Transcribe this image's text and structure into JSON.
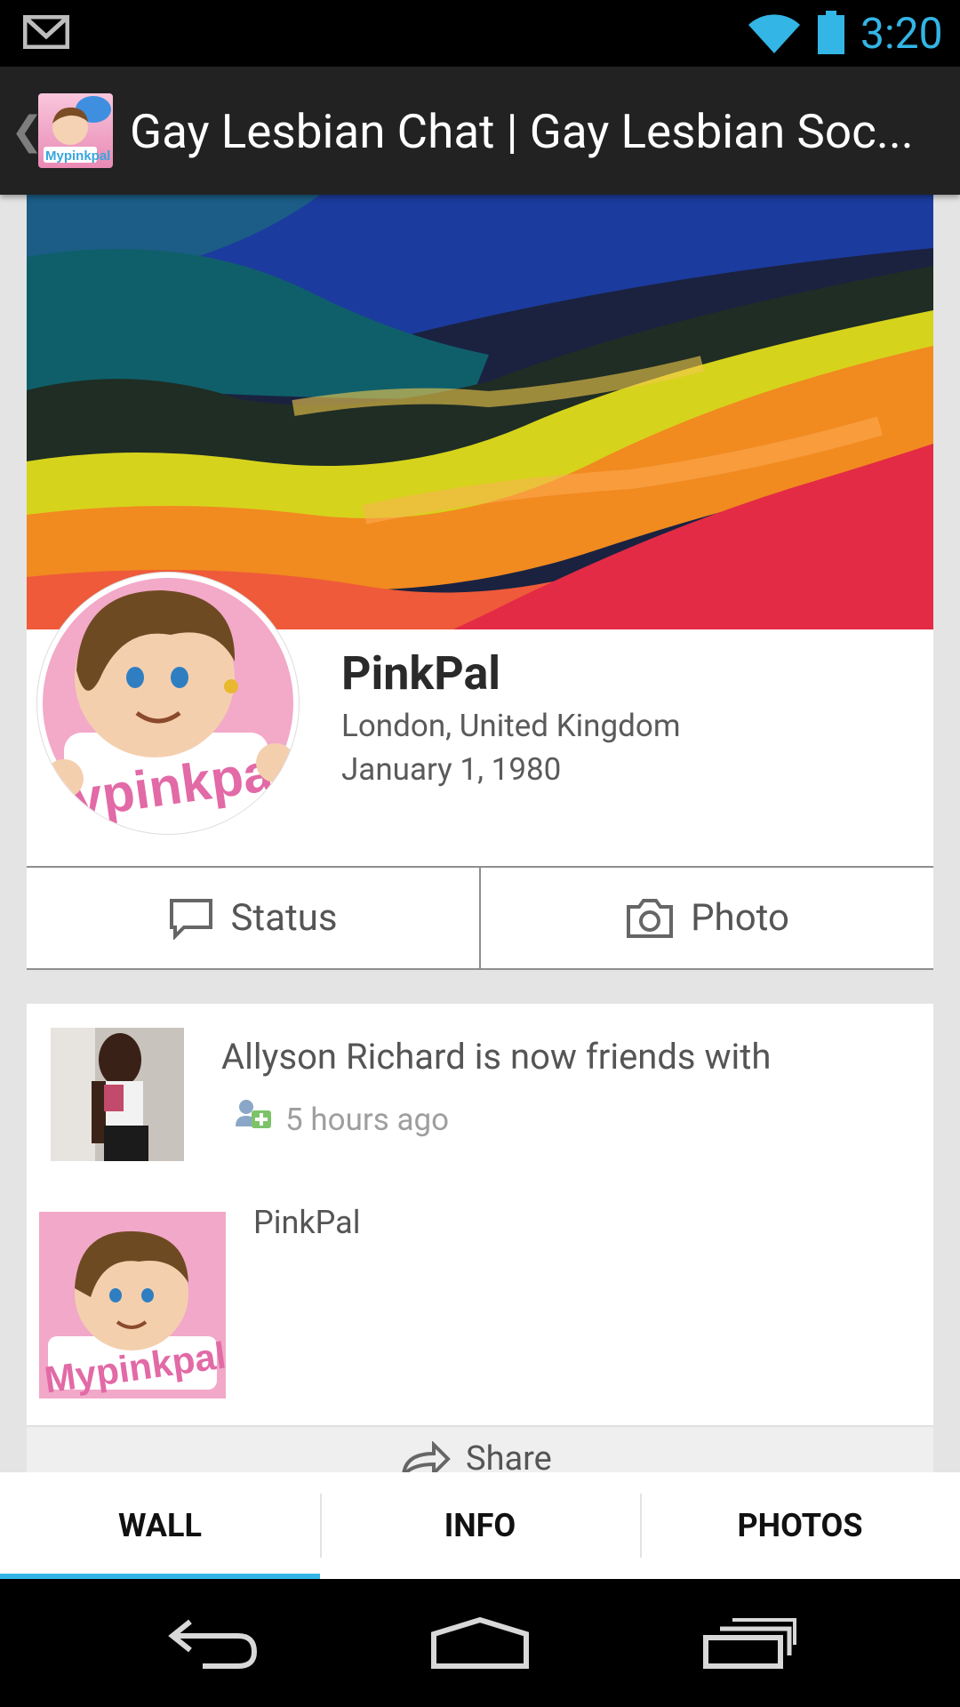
{
  "status_bar": {
    "time": "3:20",
    "icons": [
      "gmail-icon",
      "wifi-icon",
      "battery-icon"
    ],
    "accent_color": "#33b5e5"
  },
  "action_bar": {
    "title": "Gay Lesbian Chat | Gay Lesbian Soc...",
    "logo_text": "Mypinkpal"
  },
  "profile": {
    "name": "PinkPal",
    "location": "London, United Kingdom",
    "birthday": "January 1, 1980",
    "avatar_text": "ypinkpal",
    "actions": {
      "status_label": "Status",
      "photo_label": "Photo"
    }
  },
  "feed": [
    {
      "text": "Allyson Richard is now friends with",
      "time": "5 hours ago",
      "friend_name": "PinkPal",
      "thumb_text": "Mypinkpal",
      "share_label": "Share"
    }
  ],
  "tabs": [
    {
      "label": "WALL",
      "active": true
    },
    {
      "label": "INFO",
      "active": false
    },
    {
      "label": "PHOTOS",
      "active": false
    }
  ],
  "nav": [
    "back-icon",
    "home-icon",
    "recent-apps-icon"
  ]
}
